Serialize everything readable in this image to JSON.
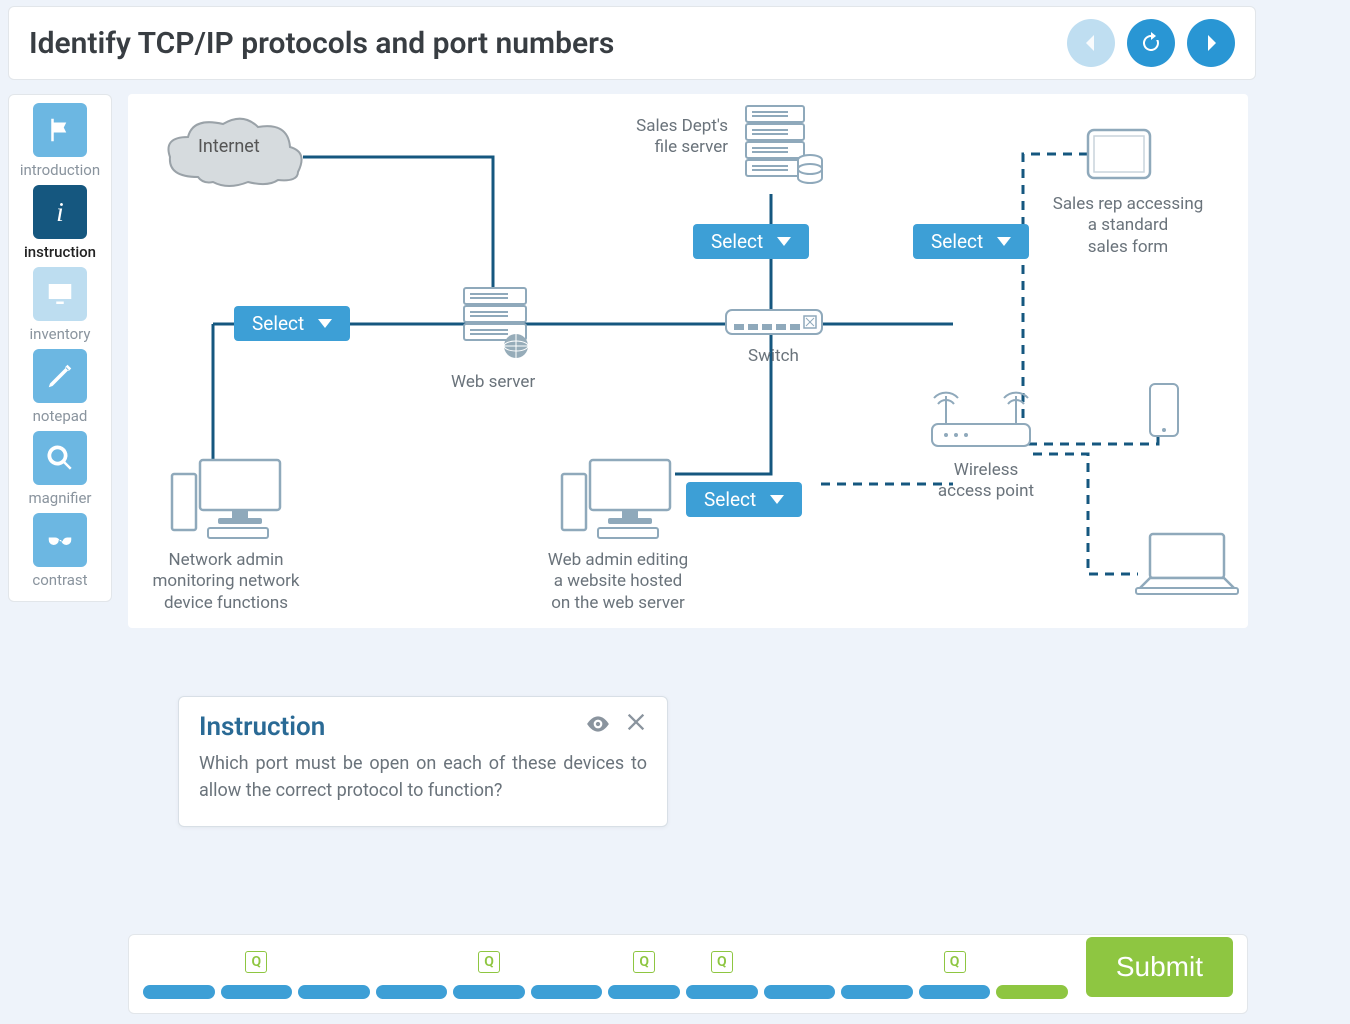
{
  "header": {
    "title": "Identify TCP/IP protocols and port numbers"
  },
  "sidebar": {
    "items": [
      {
        "id": "introduction",
        "label": "introduction",
        "state": "normal"
      },
      {
        "id": "instruction",
        "label": "instruction",
        "state": "active"
      },
      {
        "id": "inventory",
        "label": "inventory",
        "state": "faded"
      },
      {
        "id": "notepad",
        "label": "notepad",
        "state": "normal"
      },
      {
        "id": "magnifier",
        "label": "magnifier",
        "state": "normal"
      },
      {
        "id": "contrast",
        "label": "contrast",
        "state": "normal"
      }
    ]
  },
  "diagram": {
    "select_label": "Select",
    "labels": {
      "internet": "Internet",
      "file_server": "Sales Dept's\nfile server",
      "sales_rep": "Sales rep accessing\na standard\nsales form",
      "switch": "Switch",
      "web_server": "Web server",
      "wap": "Wireless\naccess point",
      "net_admin": "Network admin\nmonitoring network\ndevice functions",
      "web_admin": "Web admin editing\na website hosted\non the web server"
    }
  },
  "instruction": {
    "title": "Instruction",
    "body": "Which port must be open on each of these devices to allow the correct protocol to function?"
  },
  "footer": {
    "submit": "Submit",
    "progress": [
      {
        "q": false,
        "color": "blue"
      },
      {
        "q": true,
        "color": "blue"
      },
      {
        "q": false,
        "color": "blue"
      },
      {
        "q": false,
        "color": "blue"
      },
      {
        "q": true,
        "color": "blue"
      },
      {
        "q": false,
        "color": "blue"
      },
      {
        "q": true,
        "color": "blue"
      },
      {
        "q": true,
        "color": "blue"
      },
      {
        "q": false,
        "color": "blue"
      },
      {
        "q": false,
        "color": "blue"
      },
      {
        "q": true,
        "color": "blue"
      },
      {
        "q": false,
        "color": "green"
      }
    ]
  }
}
